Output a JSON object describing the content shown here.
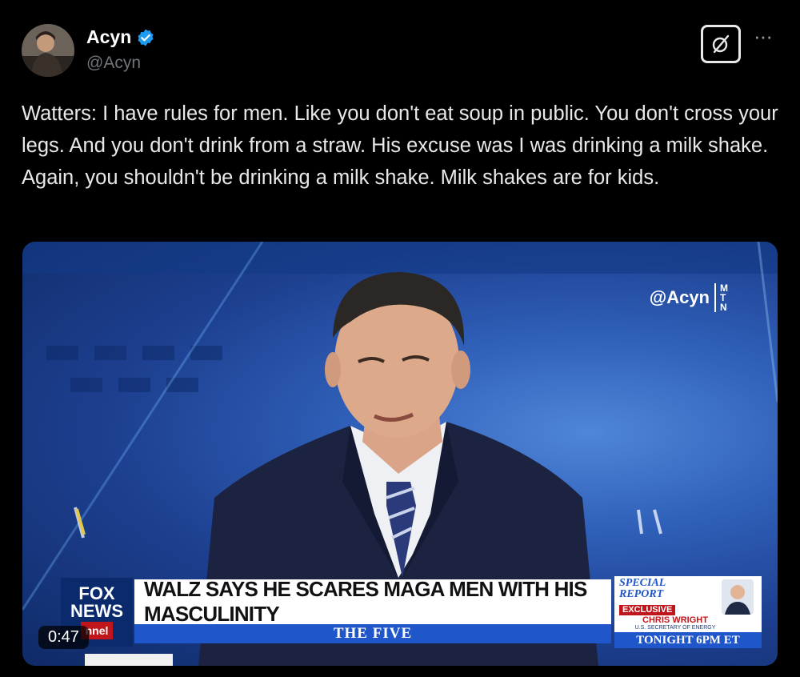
{
  "post": {
    "author": {
      "display_name": "Acyn",
      "handle": "@Acyn",
      "verified": true,
      "avatar_icon": "avatar-photo"
    },
    "text": "Watters: I have rules for men. Like you don't eat soup in public. You don't cross your legs. And you don't drink from a straw. His excuse was I was drinking a milk shake. Again, you shouldn't be drinking a milk shake. Milk shakes are for kids.",
    "actions": {
      "grok_icon": "grok-icon",
      "more_icon": "more-icon",
      "more_label": "···"
    }
  },
  "video": {
    "duration": "0:47",
    "watermark": {
      "handle": "@Acyn",
      "mtn_letters": [
        "M",
        "T",
        "N"
      ]
    },
    "chyron": {
      "network_line1": "FOX",
      "network_line2": "NEWS",
      "network_line3": "nnel",
      "headline": "WALZ SAYS HE SCARES MAGA MEN WITH HIS MASCULINITY",
      "show": "THE FIVE",
      "promo": {
        "special_line1": "SPECIAL",
        "special_line2": "REPORT",
        "exclusive": "EXCLUSIVE",
        "guest_name": "CHRIS WRIGHT",
        "guest_title": "U.S. SECRETARY OF ENERGY",
        "tonight": "TONIGHT 6PM ET"
      }
    }
  },
  "colors": {
    "background": "#000000",
    "text": "#e7e9ea",
    "secondary_text": "#71767b",
    "verified_blue": "#1d9bf0",
    "fox_blue": "#1f56c9",
    "fox_red": "#c0151a"
  }
}
